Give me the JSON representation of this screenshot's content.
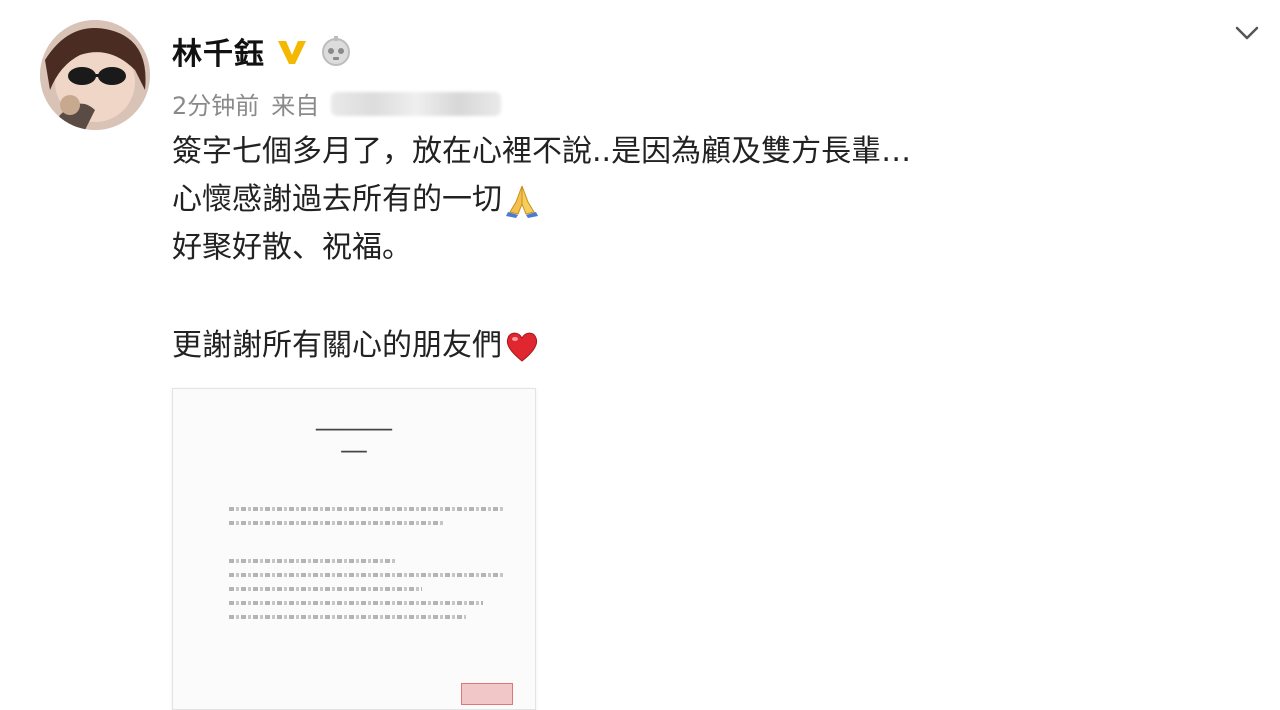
{
  "post": {
    "author": {
      "name": "林千鈺",
      "verified_icon": "verified-v-icon",
      "badge_icon": "member-badge-icon",
      "avatar": "user-avatar"
    },
    "meta": {
      "time": "2分钟前",
      "source_prefix": "来自"
    },
    "menu_icon": "chevron-down-icon",
    "lines": [
      "簽字七個多月了，放在心裡不說..是因為顧及雙方長輩…",
      "心懷感謝過去所有的一切",
      "好聚好散、祝福。",
      "",
      "更謝謝所有關心的朋友們"
    ],
    "emojis": {
      "line2": "folded-hands-icon",
      "line5": "red-heart-icon"
    },
    "colors": {
      "verified": "#f5b800",
      "heart": "#e0262f",
      "meta_gray": "#8a8a8a"
    }
  }
}
